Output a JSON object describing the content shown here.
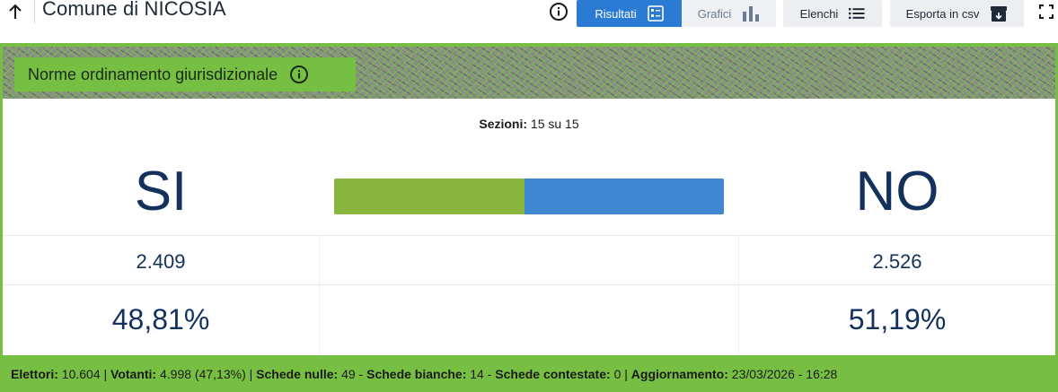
{
  "header": {
    "title": "Comune di NICOSIA",
    "buttons": {
      "risultati": "Risultati",
      "grafici": "Grafici",
      "elenchi": "Elenchi",
      "csv": "Esporta in csv"
    },
    "icons": {
      "back": "arrow-up-icon",
      "info": "info-icon",
      "risultati": "list-details-icon",
      "grafici": "bar-chart-icon",
      "elenchi": "list-icon",
      "csv": "archive-download-icon",
      "fullscreen": "fullscreen-icon"
    }
  },
  "question": {
    "title": "Norme ordinamento giurisdizionale"
  },
  "sezioni": {
    "label": "Sezioni:",
    "value": "15 su 15"
  },
  "results": {
    "si": {
      "label": "SI",
      "votes": "2.409",
      "percent": "48,81%",
      "share": 48.81
    },
    "no": {
      "label": "NO",
      "votes": "2.526",
      "percent": "51,19%",
      "share": 51.19
    }
  },
  "footer": {
    "elettori_label": "Elettori:",
    "elettori_value": "10.604",
    "votanti_label": "Votanti:",
    "votanti_value": "4.998 (47,13%)",
    "nulle_label": "Schede nulle:",
    "nulle_value": "49",
    "bianche_label": "Schede bianche:",
    "bianche_value": "14",
    "contestate_label": "Schede contestate:",
    "contestate_value": "0",
    "aggiornamento_label": "Aggiornamento:",
    "aggiornamento_value": "23/03/2026 - 16:28"
  },
  "colors": {
    "accent_green": "#77bf42",
    "si_bar": "#89b53f",
    "no_bar": "#3f87d1",
    "primary_blue": "#2b7bd4",
    "text_navy": "#13315c"
  }
}
